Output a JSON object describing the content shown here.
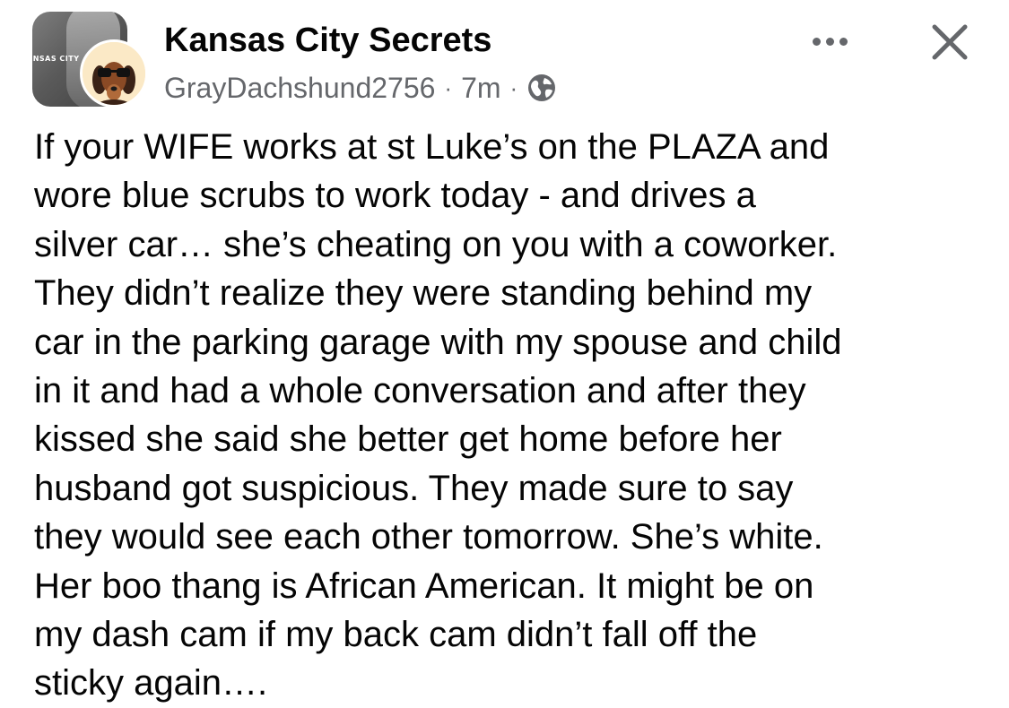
{
  "post": {
    "group_name": "Kansas City Secrets",
    "group_logo_text": "ANSAS CITY",
    "author": "GrayDachshund2756",
    "separator": "·",
    "timestamp": "7m",
    "privacy_icon": "globe-icon",
    "more_icon": "more-horizontal-icon",
    "close_icon": "close-icon",
    "body": "If your WIFE works at st Luke’s on the PLAZA and\nwore blue scrubs to work today - and drives a\nsilver car… she’s cheating on you with a coworker.\nThey didn’t realize they were standing behind my\ncar in the parking garage with my spouse and child\nin it and had a whole conversation and after they\nkissed she said she better get home before her\nhusband got suspicious. They made sure to say\nthey would see each other tomorrow. She’s white.\nHer boo thang is African American.  It might be on\nmy dash cam if my back cam didn’t fall off the\nsticky again…."
  },
  "colors": {
    "text_primary": "#050505",
    "text_secondary": "#65676b",
    "background": "#ffffff"
  }
}
